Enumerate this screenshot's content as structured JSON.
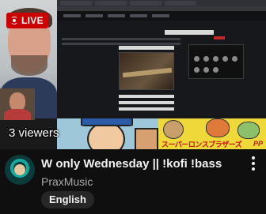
{
  "stream": {
    "live_label": "LIVE",
    "viewers": "3 viewers",
    "comic_caption": "スーパーロンスブラザーズ",
    "comic_logo": "PP"
  },
  "video": {
    "title": "W only Wednesday || !kofi !bass",
    "channel": "PraxMusic",
    "language_badge": "English"
  },
  "icons": {
    "live": "live-broadcast-icon",
    "menu": "more-vert-icon"
  },
  "colors": {
    "live_badge": "#cc0000",
    "background": "#0f0f0f",
    "title_text": "#f1f1f1",
    "channel_text": "#aaaaaa",
    "badge_bg": "#272727"
  }
}
